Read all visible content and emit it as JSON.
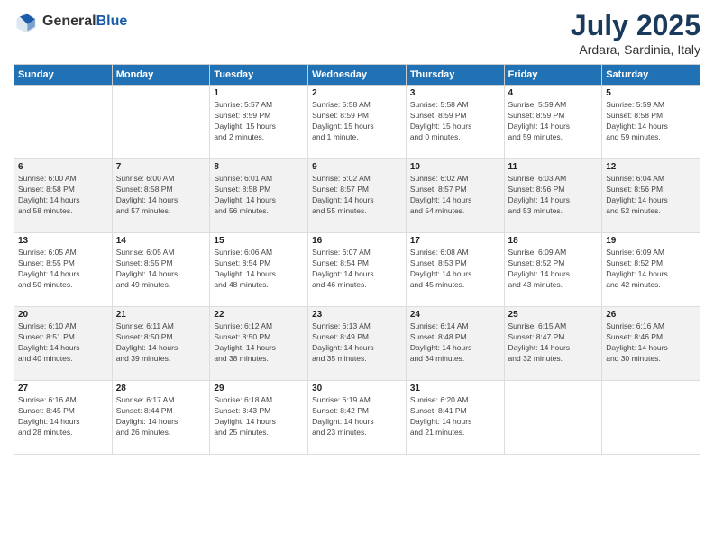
{
  "header": {
    "logo_line1": "General",
    "logo_line2": "Blue",
    "month_title": "July 2025",
    "location": "Ardara, Sardinia, Italy"
  },
  "days_of_week": [
    "Sunday",
    "Monday",
    "Tuesday",
    "Wednesday",
    "Thursday",
    "Friday",
    "Saturday"
  ],
  "weeks": [
    [
      {
        "day": "",
        "info": ""
      },
      {
        "day": "",
        "info": ""
      },
      {
        "day": "1",
        "info": "Sunrise: 5:57 AM\nSunset: 8:59 PM\nDaylight: 15 hours\nand 2 minutes."
      },
      {
        "day": "2",
        "info": "Sunrise: 5:58 AM\nSunset: 8:59 PM\nDaylight: 15 hours\nand 1 minute."
      },
      {
        "day": "3",
        "info": "Sunrise: 5:58 AM\nSunset: 8:59 PM\nDaylight: 15 hours\nand 0 minutes."
      },
      {
        "day": "4",
        "info": "Sunrise: 5:59 AM\nSunset: 8:59 PM\nDaylight: 14 hours\nand 59 minutes."
      },
      {
        "day": "5",
        "info": "Sunrise: 5:59 AM\nSunset: 8:58 PM\nDaylight: 14 hours\nand 59 minutes."
      }
    ],
    [
      {
        "day": "6",
        "info": "Sunrise: 6:00 AM\nSunset: 8:58 PM\nDaylight: 14 hours\nand 58 minutes."
      },
      {
        "day": "7",
        "info": "Sunrise: 6:00 AM\nSunset: 8:58 PM\nDaylight: 14 hours\nand 57 minutes."
      },
      {
        "day": "8",
        "info": "Sunrise: 6:01 AM\nSunset: 8:58 PM\nDaylight: 14 hours\nand 56 minutes."
      },
      {
        "day": "9",
        "info": "Sunrise: 6:02 AM\nSunset: 8:57 PM\nDaylight: 14 hours\nand 55 minutes."
      },
      {
        "day": "10",
        "info": "Sunrise: 6:02 AM\nSunset: 8:57 PM\nDaylight: 14 hours\nand 54 minutes."
      },
      {
        "day": "11",
        "info": "Sunrise: 6:03 AM\nSunset: 8:56 PM\nDaylight: 14 hours\nand 53 minutes."
      },
      {
        "day": "12",
        "info": "Sunrise: 6:04 AM\nSunset: 8:56 PM\nDaylight: 14 hours\nand 52 minutes."
      }
    ],
    [
      {
        "day": "13",
        "info": "Sunrise: 6:05 AM\nSunset: 8:55 PM\nDaylight: 14 hours\nand 50 minutes."
      },
      {
        "day": "14",
        "info": "Sunrise: 6:05 AM\nSunset: 8:55 PM\nDaylight: 14 hours\nand 49 minutes."
      },
      {
        "day": "15",
        "info": "Sunrise: 6:06 AM\nSunset: 8:54 PM\nDaylight: 14 hours\nand 48 minutes."
      },
      {
        "day": "16",
        "info": "Sunrise: 6:07 AM\nSunset: 8:54 PM\nDaylight: 14 hours\nand 46 minutes."
      },
      {
        "day": "17",
        "info": "Sunrise: 6:08 AM\nSunset: 8:53 PM\nDaylight: 14 hours\nand 45 minutes."
      },
      {
        "day": "18",
        "info": "Sunrise: 6:09 AM\nSunset: 8:52 PM\nDaylight: 14 hours\nand 43 minutes."
      },
      {
        "day": "19",
        "info": "Sunrise: 6:09 AM\nSunset: 8:52 PM\nDaylight: 14 hours\nand 42 minutes."
      }
    ],
    [
      {
        "day": "20",
        "info": "Sunrise: 6:10 AM\nSunset: 8:51 PM\nDaylight: 14 hours\nand 40 minutes."
      },
      {
        "day": "21",
        "info": "Sunrise: 6:11 AM\nSunset: 8:50 PM\nDaylight: 14 hours\nand 39 minutes."
      },
      {
        "day": "22",
        "info": "Sunrise: 6:12 AM\nSunset: 8:50 PM\nDaylight: 14 hours\nand 38 minutes."
      },
      {
        "day": "23",
        "info": "Sunrise: 6:13 AM\nSunset: 8:49 PM\nDaylight: 14 hours\nand 35 minutes."
      },
      {
        "day": "24",
        "info": "Sunrise: 6:14 AM\nSunset: 8:48 PM\nDaylight: 14 hours\nand 34 minutes."
      },
      {
        "day": "25",
        "info": "Sunrise: 6:15 AM\nSunset: 8:47 PM\nDaylight: 14 hours\nand 32 minutes."
      },
      {
        "day": "26",
        "info": "Sunrise: 6:16 AM\nSunset: 8:46 PM\nDaylight: 14 hours\nand 30 minutes."
      }
    ],
    [
      {
        "day": "27",
        "info": "Sunrise: 6:16 AM\nSunset: 8:45 PM\nDaylight: 14 hours\nand 28 minutes."
      },
      {
        "day": "28",
        "info": "Sunrise: 6:17 AM\nSunset: 8:44 PM\nDaylight: 14 hours\nand 26 minutes."
      },
      {
        "day": "29",
        "info": "Sunrise: 6:18 AM\nSunset: 8:43 PM\nDaylight: 14 hours\nand 25 minutes."
      },
      {
        "day": "30",
        "info": "Sunrise: 6:19 AM\nSunset: 8:42 PM\nDaylight: 14 hours\nand 23 minutes."
      },
      {
        "day": "31",
        "info": "Sunrise: 6:20 AM\nSunset: 8:41 PM\nDaylight: 14 hours\nand 21 minutes."
      },
      {
        "day": "",
        "info": ""
      },
      {
        "day": "",
        "info": ""
      }
    ]
  ]
}
